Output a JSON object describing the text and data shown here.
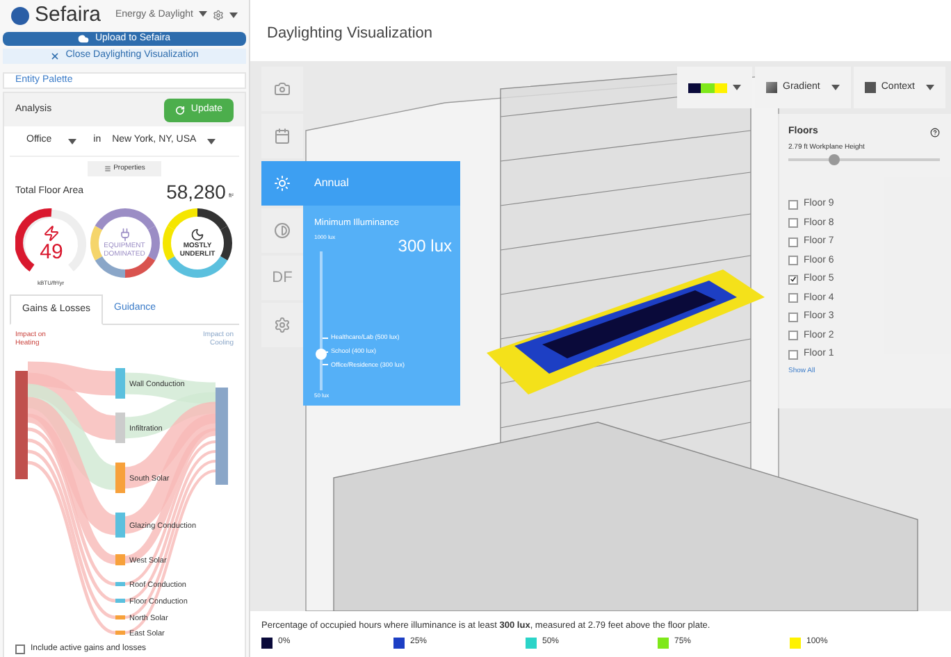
{
  "brand": {
    "name": "Sefaira",
    "mode": "Energy & Daylight"
  },
  "buttons": {
    "upload": "Upload to Sefaira",
    "close": "Close Daylighting Visualization"
  },
  "entity_palette": "Entity Palette",
  "analysis": {
    "title": "Analysis",
    "update": "Update",
    "building_type": "Office",
    "in": "in",
    "location": "New York, NY, USA",
    "properties": "Properties",
    "floor_area_label": "Total Floor Area",
    "floor_area": "58,280",
    "floor_area_unit": "ft²"
  },
  "gauges": [
    {
      "kind": "eui",
      "value": "49",
      "unit": "kBTU/ft²/yr"
    },
    {
      "kind": "equipment",
      "label": "EQUIPMENT DOMINATED"
    },
    {
      "kind": "underlit",
      "label": "MOSTLY UNDERLIT"
    }
  ],
  "tabs": [
    {
      "label": "Gains & Losses",
      "selected": true
    },
    {
      "label": "Guidance",
      "selected": false
    }
  ],
  "sankey": {
    "left_label": "Impact on Heating",
    "right_label": "Impact on Cooling",
    "nodes": [
      {
        "label": "Wall Conduction",
        "color": "#5bc0de"
      },
      {
        "label": "Infiltration",
        "color": "#cccccc"
      },
      {
        "label": "South Solar",
        "color": "#f7a13b"
      },
      {
        "label": "Glazing Conduction",
        "color": "#5bc0de"
      },
      {
        "label": "West Solar",
        "color": "#f7a13b"
      },
      {
        "label": "Roof Conduction",
        "color": "#5bc0de"
      },
      {
        "label": "Floor Conduction",
        "color": "#5bc0de"
      },
      {
        "label": "North Solar",
        "color": "#f7a13b"
      },
      {
        "label": "East Solar",
        "color": "#f7a13b"
      }
    ]
  },
  "include_active": {
    "label": "Include active gains and losses",
    "checked": false
  },
  "main": {
    "title": "Daylighting Visualization"
  },
  "toolbar": {
    "gradient": "Gradient",
    "context": "Context"
  },
  "tools": [
    {
      "selected": false
    },
    {
      "selected": false
    },
    {
      "selected": true
    },
    {
      "selected": false
    },
    {
      "label": "DF",
      "selected": false
    },
    {
      "selected": false
    }
  ],
  "annual": {
    "title": "Annual",
    "heading": "Minimum Illuminance",
    "top": "1000 lux",
    "bottom": "50 lux",
    "value": "300 lux",
    "level": 0.26,
    "marks": [
      "Healthcare/Lab (500 lux)",
      "School (400 lux)",
      "Office/Residence (300 lux)"
    ]
  },
  "floors": {
    "title": "Floors",
    "workplane": "2.79 ft Workplane Height",
    "level": 0.3,
    "items": [
      {
        "label": "Floor 9",
        "checked": false
      },
      {
        "label": "Floor 8",
        "checked": false
      },
      {
        "label": "Floor 7",
        "checked": false
      },
      {
        "label": "Floor 6",
        "checked": false
      },
      {
        "label": "Floor 5",
        "checked": true
      },
      {
        "label": "Floor 4",
        "checked": false
      },
      {
        "label": "Floor 3",
        "checked": false
      },
      {
        "label": "Floor 2",
        "checked": false
      },
      {
        "label": "Floor 1",
        "checked": false
      }
    ],
    "show_all": "Show All"
  },
  "caption": {
    "text": "Percentage of occupied hours where illuminance is at least **300 lux**, measured at 2.79 feet above the floor plate."
  },
  "legend": [
    {
      "label": "0%",
      "color": "#0a0a3a"
    },
    {
      "label": "25%",
      "color": "#1d3fc4"
    },
    {
      "label": "50%",
      "color": "#2bd4c8"
    },
    {
      "label": "75%",
      "color": "#7fe81a"
    },
    {
      "label": "100%",
      "color": "#fff200"
    }
  ]
}
